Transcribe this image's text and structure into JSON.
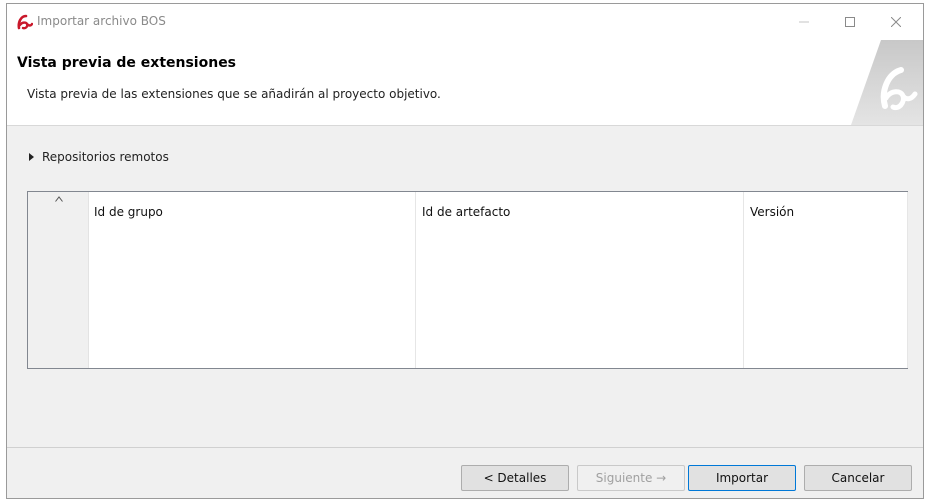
{
  "window": {
    "title": "Importar archivo BOS"
  },
  "header": {
    "title": "Vista previa de extensiones",
    "subtitle": "Vista previa de las extensiones que se añadirán al proyecto objetivo."
  },
  "repositories": {
    "label": "Repositorios remotos",
    "expanded": false
  },
  "table": {
    "columns": [
      "Id de grupo",
      "Id de artefacto",
      "Versión"
    ],
    "rows": []
  },
  "buttons": {
    "details": "< Detalles",
    "next": "Siguiente →",
    "import": "Importar",
    "cancel": "Cancelar"
  },
  "colors": {
    "accent": "#0078d7",
    "logo": "#c9182b"
  }
}
